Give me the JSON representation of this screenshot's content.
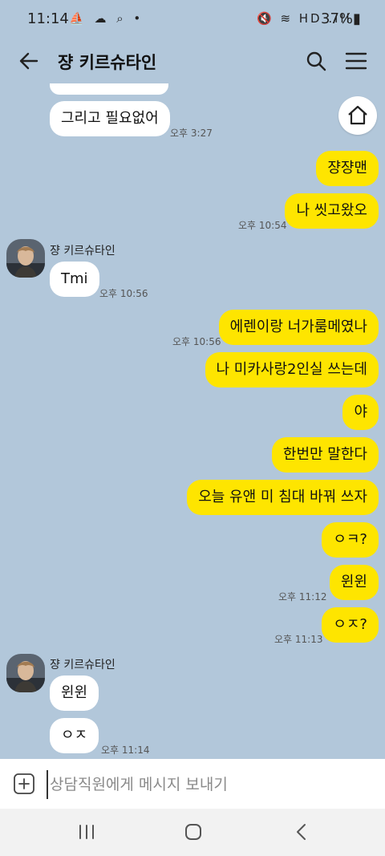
{
  "status_bar": {
    "time": "11:14",
    "left_icons": "⛵ ☁ ⌕ •",
    "right_icons": "🔇 ≋ HD .ıll",
    "battery": "37%▮"
  },
  "header": {
    "title": "쟝 키르슈타인",
    "icons": [
      "back-arrow-icon",
      "search-icon",
      "menu-icon"
    ]
  },
  "messages": [
    {
      "side": "left",
      "text": "그리고 필요없어",
      "time": "오후 3:27"
    },
    {
      "side": "right",
      "text": "쟝쟝맨"
    },
    {
      "side": "right",
      "text": "나 씻고왔오",
      "time": "오후 10:54"
    },
    {
      "side": "left",
      "sender": "쟝 키르슈타인",
      "text": "Tmi",
      "time": "오후 10:56"
    },
    {
      "side": "right",
      "text": "에렌이랑 너가룸메였나",
      "time": "오후 10:56"
    },
    {
      "side": "right",
      "text": "나 미카사랑2인실 쓰는데"
    },
    {
      "side": "right",
      "text": "야"
    },
    {
      "side": "right",
      "text": "한번만 말한다"
    },
    {
      "side": "right",
      "text": "오늘 유앤 미 침대 바꿔 쓰자"
    },
    {
      "side": "right",
      "text": "ㅇㅋ?"
    },
    {
      "side": "right",
      "text": "윈윈",
      "time": "오후 11:12"
    },
    {
      "side": "right",
      "text": "ㅇㅈ?",
      "time": "오후 11:13"
    },
    {
      "side": "left",
      "sender": "쟝 키르슈타인",
      "text": "윈윈"
    },
    {
      "side": "left",
      "text": "ㅇㅈ",
      "time": "오후 11:14"
    }
  ],
  "input": {
    "placeholder": "상담직원에게 메시지 보내기",
    "value": ""
  },
  "colors": {
    "background": "#b2c7da",
    "my_bubble": "#fee500",
    "their_bubble": "#ffffff"
  }
}
